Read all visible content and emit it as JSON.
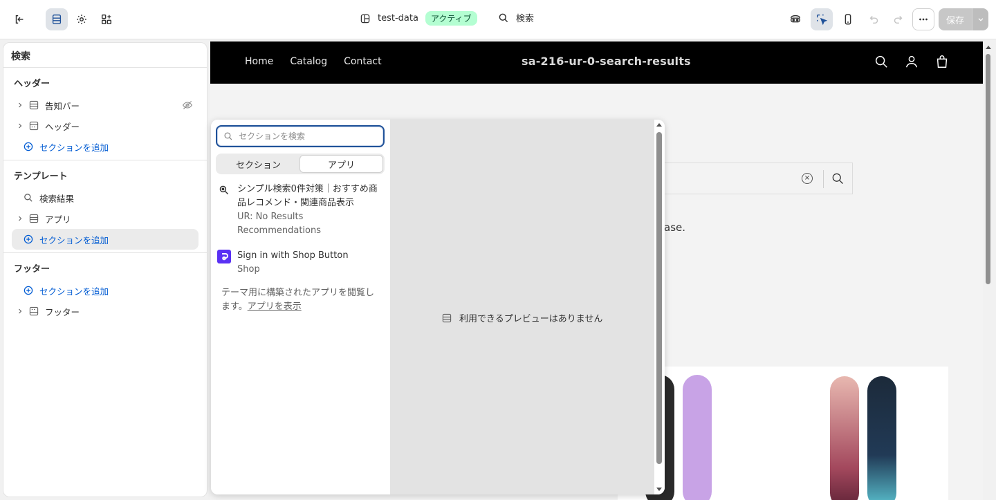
{
  "topbar": {
    "theme_name": "test-data",
    "status_badge": "アクティブ",
    "page_search_label": "検索",
    "save_label": "保存"
  },
  "sidebar": {
    "title": "検索",
    "groups": [
      {
        "title": "ヘッダー",
        "items": [
          {
            "label": "告知バー",
            "icon": "section-icon",
            "hidden": true
          },
          {
            "label": "ヘッダー",
            "icon": "header-icon"
          },
          {
            "label": "セクションを追加",
            "icon": "plus-circle-icon"
          }
        ]
      },
      {
        "title": "テンプレート",
        "items": [
          {
            "label": "検索結果",
            "icon": "search-icon"
          },
          {
            "label": "アプリ",
            "icon": "section-icon"
          },
          {
            "label": "セクションを追加",
            "icon": "plus-circle-icon",
            "selected": true
          }
        ]
      },
      {
        "title": "フッター",
        "items": [
          {
            "label": "セクションを追加",
            "icon": "plus-circle-icon"
          },
          {
            "label": "フッター",
            "icon": "footer-icon"
          }
        ]
      }
    ]
  },
  "store": {
    "nav": [
      "Home",
      "Catalog",
      "Contact"
    ],
    "title": "sa-216-ur-0-search-results",
    "body_text_fragment": "ase."
  },
  "popover": {
    "search_placeholder": "セクションを検索",
    "tabs": [
      "セクション",
      "アプリ"
    ],
    "active_tab": "アプリ",
    "apps": [
      {
        "name": "シンプル検索0件対策｜おすすめ商品レコメンド・関連商品表示",
        "vendor": "UR: No Results Recommendations",
        "icon": "magnifier-app-icon"
      },
      {
        "name": "Sign in with Shop Button",
        "vendor": "Shop",
        "icon": "shop-app-icon"
      }
    ],
    "footer_text": "テーマ用に構築されたアプリを閲覧します。",
    "footer_link": "アプリを表示",
    "preview_empty": "利用できるプレビューはありません"
  },
  "colors": {
    "accent": "#005bd3",
    "badge_bg": "#b4fed2",
    "store_header_bg": "#000000",
    "shop_purple": "#5a31f4"
  }
}
